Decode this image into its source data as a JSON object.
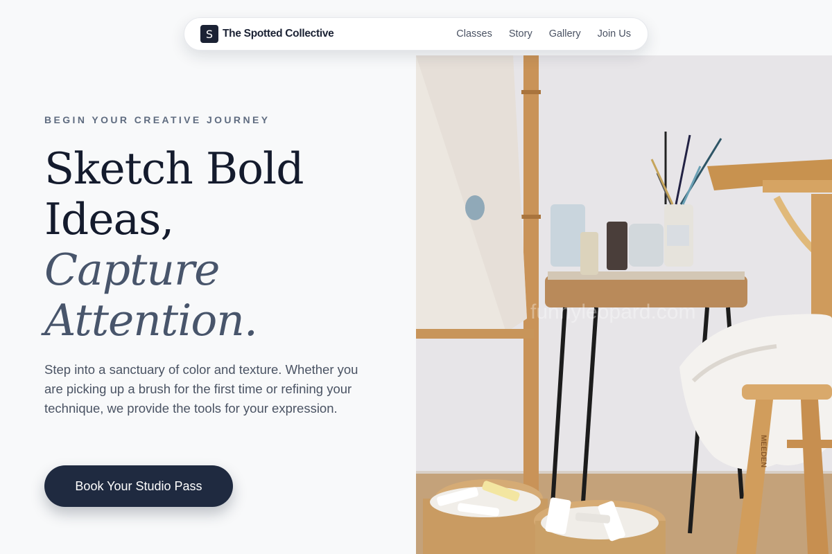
{
  "nav": {
    "brand_mark": "S",
    "brand_name": "The Spotted Collective",
    "links": [
      "Classes",
      "Story",
      "Gallery",
      "Join Us"
    ]
  },
  "hero": {
    "eyebrow": "BEGIN YOUR CREATIVE JOURNEY",
    "headline_lines": [
      "Sketch Bold",
      "Ideas,"
    ],
    "headline_italic_lines": [
      "Capture",
      "Attention."
    ],
    "intro": "Step into a sanctuary of color and texture. Whether you are picking up a brush for the first time or refining your technique, we provide the tools for your expression.",
    "cta_label": "Book Your Studio Pass"
  },
  "photo": {
    "watermark": "funnyleopard.com",
    "stool_brand": "MEEDEN"
  },
  "colors": {
    "navy": "#1f2a40",
    "muted_slate": "#48556b",
    "eyebrow": "#5f6c80"
  }
}
